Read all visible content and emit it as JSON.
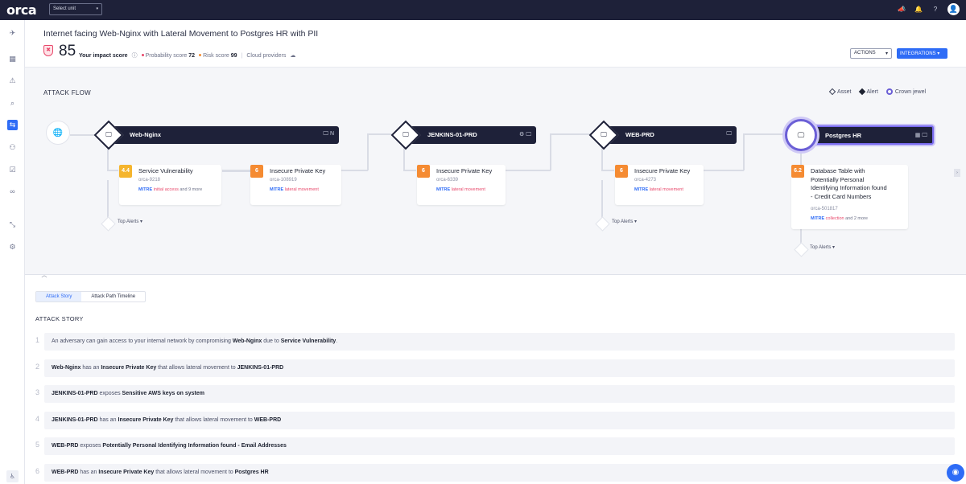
{
  "topbar": {
    "logo": "orca",
    "unit_select": "Select unit",
    "caret": "▾",
    "icons": [
      "megaphone-icon",
      "bell-icon",
      "help-icon",
      "user-icon"
    ]
  },
  "sidebar": {
    "items": [
      "rocket-icon",
      "dashboard-icon",
      "alert-icon",
      "search-icon",
      "attack-path-icon",
      "graph-icon",
      "compliance-icon",
      "glasses-icon",
      "integrations-icon",
      "settings-icon"
    ],
    "active_index": 4
  },
  "header": {
    "title": "Internet facing Web-Nginx with Lateral Movement to Postgres HR with PII",
    "impact_score": "85",
    "impact_label": "Your impact score",
    "probability_label": "Probability score",
    "probability_value": "72",
    "risk_label": "Risk score",
    "risk_value": "99",
    "cloud_label": "Cloud providers",
    "actions_label": "ACTIONS",
    "integrations_label": "INTEGRATIONS ▾",
    "colors": {
      "probability": "#e8476a",
      "risk": "#f58b32",
      "accent": "#2e6cf6"
    }
  },
  "flow": {
    "title": "ATTACK FLOW",
    "legend": {
      "asset": "Asset",
      "alert": "Alert",
      "crown": "Crown jewel"
    },
    "assets": [
      {
        "name": "Web-Nginx",
        "icons": "🖵 N"
      },
      {
        "name": "JENKINS-01-PRD",
        "icons": "⚙ 🖵"
      },
      {
        "name": "WEB-PRD",
        "icons": "🖵"
      },
      {
        "name": "Postgres HR",
        "icons": "▦ 🖵"
      }
    ],
    "alerts": [
      {
        "score": "4.4",
        "title": "Service Vulnerability",
        "id": "orca-9218",
        "mitre": "MITRE",
        "tactic": "initial access",
        "more": "and 9 more"
      },
      {
        "score": "6",
        "title": "Insecure Private Key",
        "id": "orca-108919",
        "mitre": "MITRE",
        "tactic": "lateral movement",
        "more": ""
      },
      {
        "score": "6",
        "title": "Insecure Private Key",
        "id": "orca-6339",
        "mitre": "MITRE",
        "tactic": "lateral movement",
        "more": ""
      },
      {
        "score": "6",
        "title": "Insecure Private Key",
        "id": "orca-4273",
        "mitre": "MITRE",
        "tactic": "lateral movement",
        "more": ""
      },
      {
        "score": "6.2",
        "title_lines": [
          "Database Table with",
          "Potentially Personal",
          "Identifying Information found",
          "- Credit Card Numbers"
        ],
        "id": "orca-501817",
        "mitre": "MITRE",
        "tactic": "collection",
        "more": "and 2 more"
      }
    ],
    "top_alerts_label": "Top Alerts ▾"
  },
  "tabs": {
    "story": "Attack Story",
    "timeline": "Attack Path Timeline"
  },
  "story": {
    "title": "ATTACK STORY",
    "rows": [
      {
        "num": "1",
        "parts": [
          "An adversary can gain access to your internal network by compromising ",
          "Web-Nginx",
          " due to ",
          "Service Vulnerability",
          "."
        ]
      },
      {
        "num": "2",
        "parts": [
          "",
          "Web-Nginx",
          " has an ",
          "Insecure Private Key",
          " that allows lateral movement to ",
          "JENKINS-01-PRD"
        ]
      },
      {
        "num": "3",
        "parts": [
          "",
          "JENKINS-01-PRD",
          " exposes ",
          "Sensitive AWS keys on system"
        ]
      },
      {
        "num": "4",
        "parts": [
          "",
          "JENKINS-01-PRD",
          " has an ",
          "Insecure Private Key",
          " that allows lateral movement to ",
          "WEB-PRD"
        ]
      },
      {
        "num": "5",
        "parts": [
          "",
          "WEB-PRD",
          " exposes ",
          "Potentially Personal Identifying Information found - Email Addresses"
        ]
      },
      {
        "num": "6",
        "parts": [
          "",
          "WEB-PRD",
          " has an ",
          "Insecure Private Key",
          " that allows lateral movement to ",
          "Postgres HR"
        ]
      }
    ]
  }
}
